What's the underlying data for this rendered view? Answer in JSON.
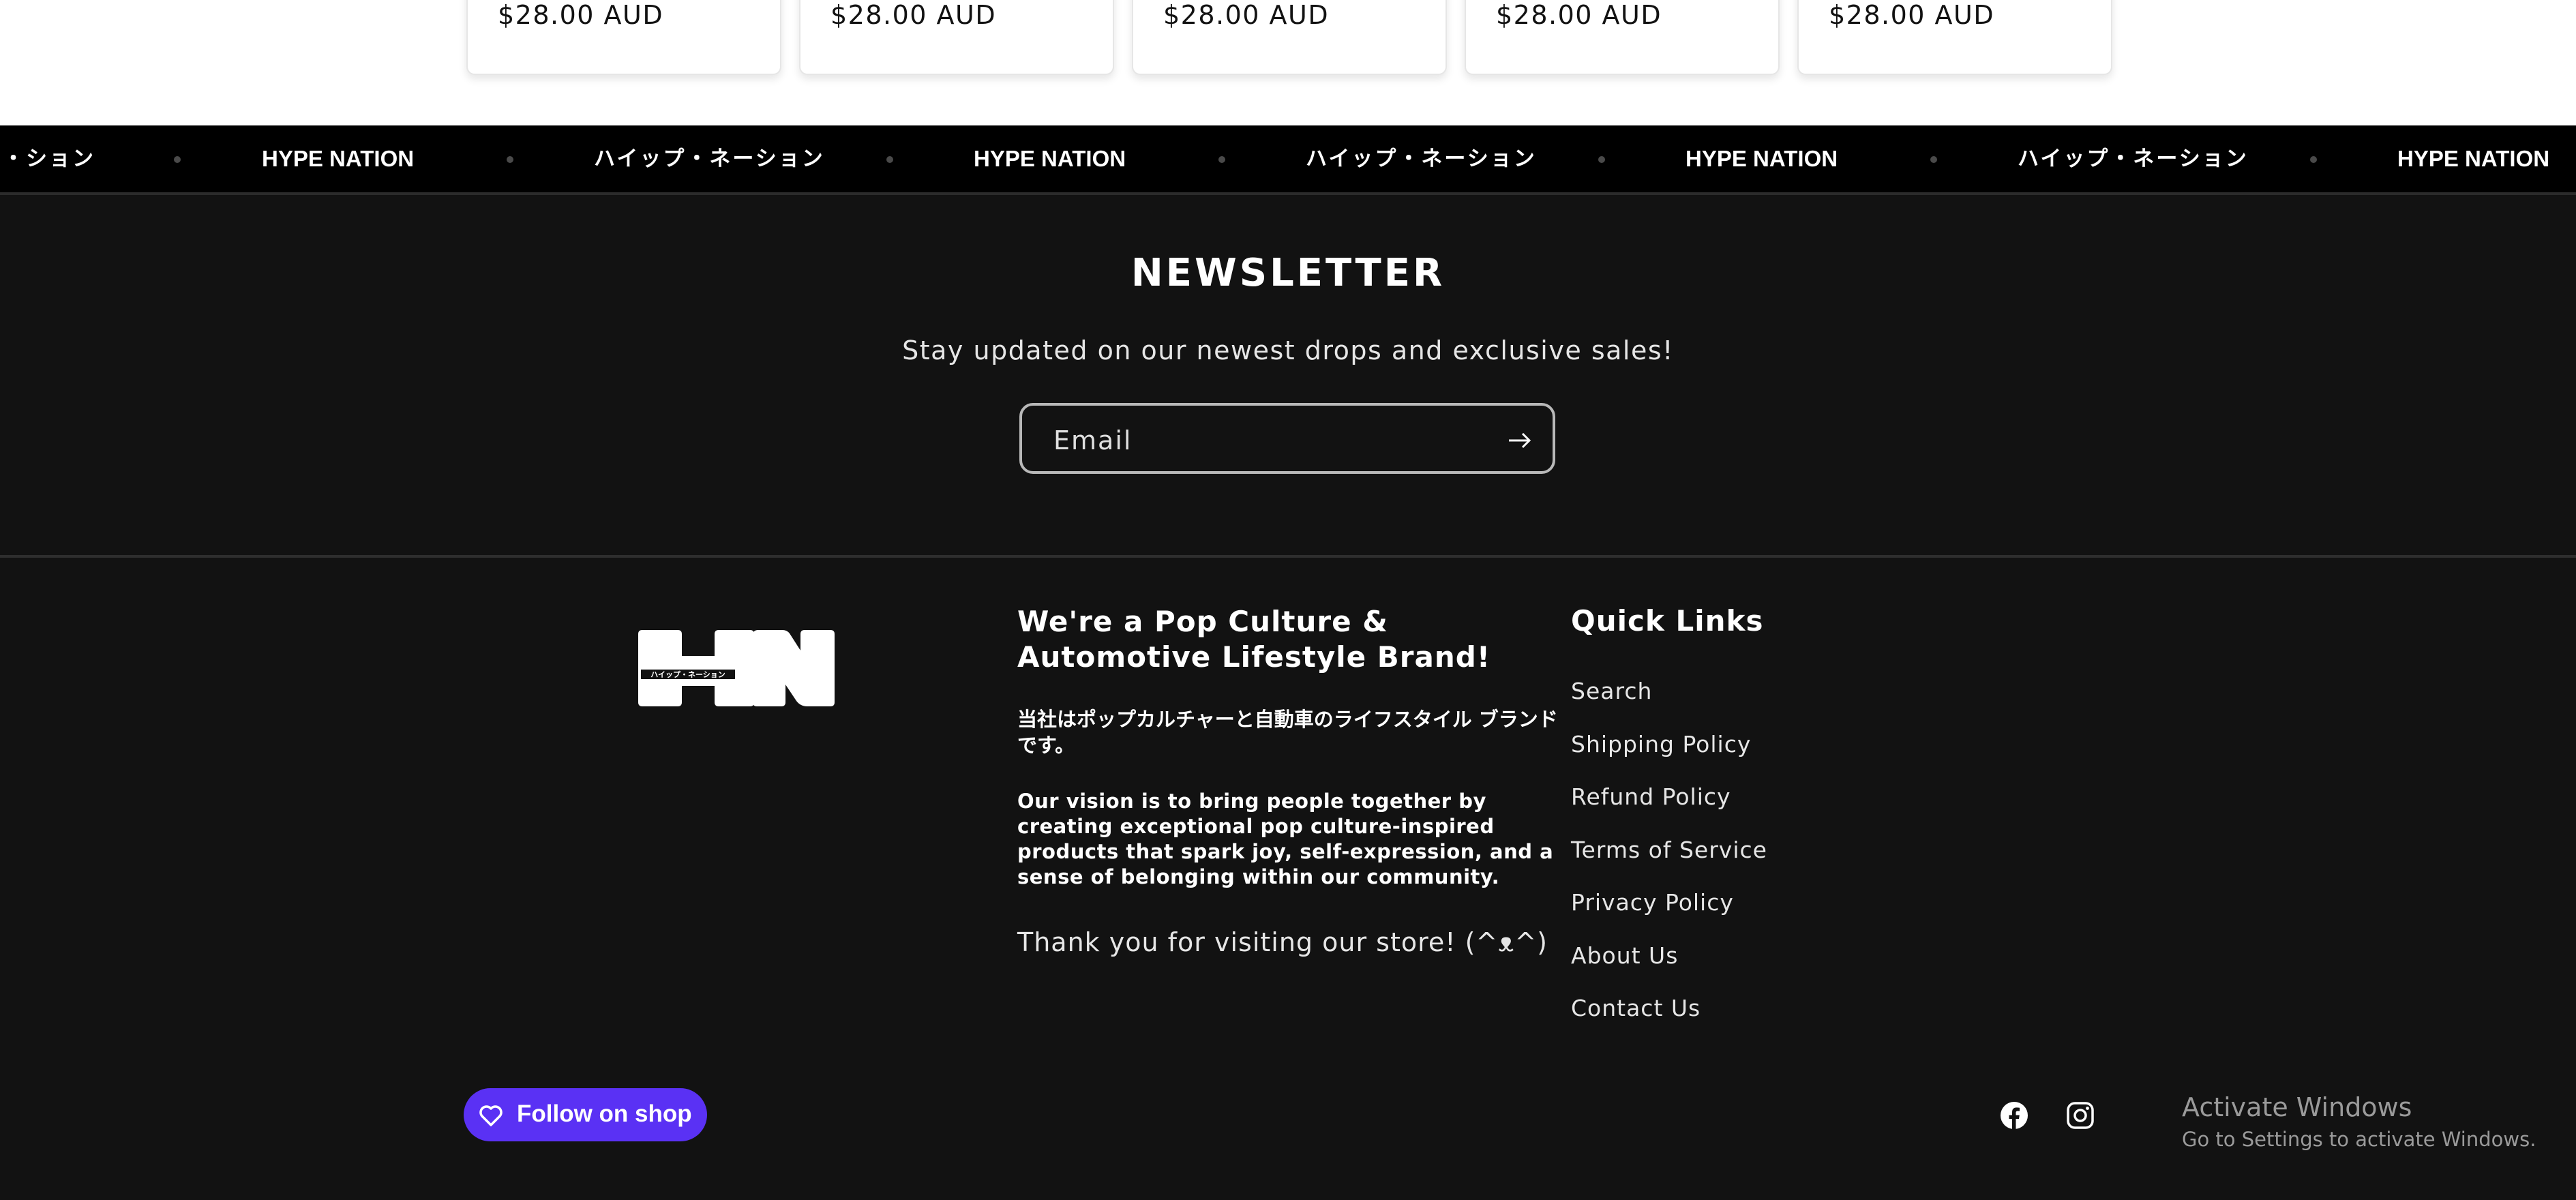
{
  "product_cards": [
    {
      "price": "$28.00 AUD"
    },
    {
      "price": "$28.00 AUD"
    },
    {
      "price": "$28.00 AUD"
    },
    {
      "price": "$28.00 AUD"
    },
    {
      "price": "$28.00 AUD"
    }
  ],
  "marquee": {
    "items": [
      "・ション",
      "HYPE NATION",
      "ハイップ・ネーション",
      "HYPE NATION",
      "ハイップ・ネーション",
      "HYPE NATION",
      "ハイップ・ネーション",
      "HYPE NATION"
    ]
  },
  "newsletter": {
    "title": "NEWSLETTER",
    "subtitle": "Stay updated on our newest drops and exclusive sales!",
    "email_placeholder": "Email",
    "submit_icon": "arrow-right-icon"
  },
  "footer": {
    "logo_text": "HN",
    "logo_subtext": "ハイップ・ネーション",
    "about_heading": "We're a Pop Culture & Automotive Lifestyle Brand!",
    "about_jp": "当社はポップカルチャーと自動車のライフスタイル ブランドです。",
    "about_vision": "Our vision is to bring people together by creating exceptional pop culture-inspired products that spark joy, self-expression, and a sense of belonging within our community.",
    "thanks": "Thank you for visiting our store! (^ᴥ^)",
    "quick_links_heading": "Quick Links",
    "quick_links": [
      "Search",
      "Shipping Policy",
      "Refund Policy",
      "Terms of Service",
      "Privacy Policy",
      "About Us",
      "Contact Us"
    ],
    "follow_button": "Follow on shop",
    "follow_icon": "heart-icon",
    "socials": [
      "facebook-icon",
      "instagram-icon"
    ]
  },
  "windows_watermark": {
    "title": "Activate Windows",
    "subtitle": "Go to Settings to activate Windows."
  },
  "colors": {
    "background": "#121212",
    "marquee_bg": "#000000",
    "shop_purple": "#5a31f4"
  }
}
